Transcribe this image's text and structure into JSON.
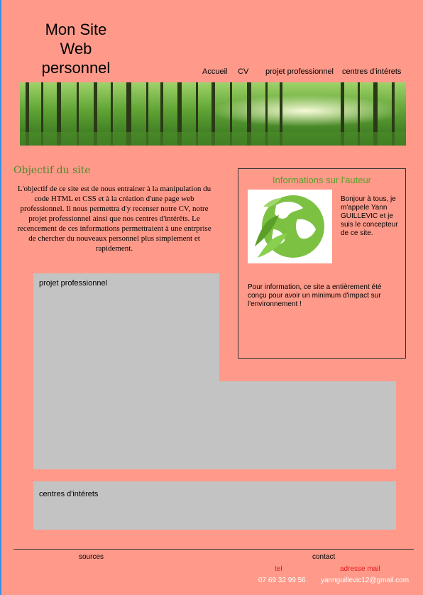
{
  "header": {
    "title_line1": "Mon Site",
    "title_line2": "Web",
    "title_line3": "personnel"
  },
  "nav": {
    "items": [
      "Accueil",
      "CV",
      "projet professionnel",
      "centres d'intérets"
    ]
  },
  "objectif": {
    "title": "Objectif du site",
    "text": "L'objectif de ce site est de nous entrainer à la manipulation du code HTML et CSS et à la création d'une page web professionnel. Il nous permettra d'y recenser notre CV, notre projet professionnel ainsi que nos centres d'intérêts. Le recencement de ces informations permettraient à une entrprise de chercher du nouveaux personnel plus simplement et rapidement."
  },
  "author": {
    "title": "Informations sur l'auteur",
    "intro": "Bonjour à tous, je m'appele Yann GUILLEVIC et je suis le concepteur de ce site.",
    "note": "Pour information, ce site a entièrement été conçu pour avoir un minimum d'impact sur l'environnement !",
    "image_icon": "green-earth-icon"
  },
  "sections": {
    "projet": "projet professionnel",
    "centres": "centres d'intérets"
  },
  "footer": {
    "sources": "sources",
    "contact": "contact",
    "tel_label": "tel",
    "mail_label": "adresse mail",
    "tel": "07 69 32 99 56",
    "mail": "yannguillevic12@gmail.com"
  },
  "colors": {
    "background": "#ff9a8a",
    "panel": "#c3c3c3",
    "accent_green": "#5aa028",
    "contact_label_red": "#e21b1b"
  }
}
